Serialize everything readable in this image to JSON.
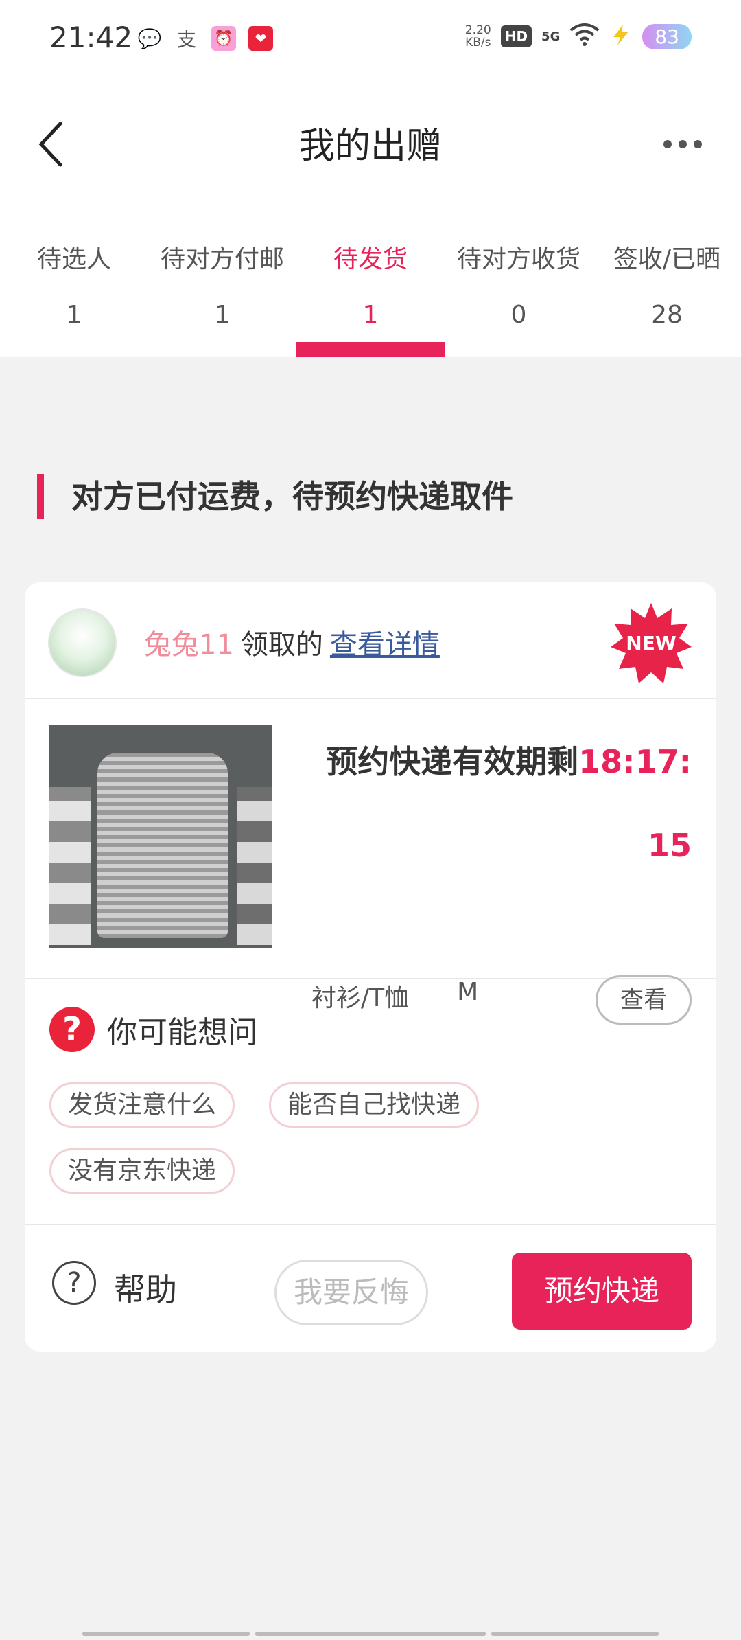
{
  "status_bar": {
    "time": "21:42",
    "apps": [
      {
        "icon": "wechat-icon",
        "glyph": "💬"
      },
      {
        "icon": "alipay-icon",
        "glyph": "支"
      },
      {
        "icon": "clock-app-icon",
        "glyph": "⏰"
      },
      {
        "icon": "taobao-618-icon",
        "glyph": "❤"
      }
    ],
    "net_speed_value": "2.20",
    "net_speed_unit": "KB/s",
    "hd": "HD",
    "signal": "5G",
    "battery": "83"
  },
  "header": {
    "title": "我的出赠"
  },
  "tabs": [
    {
      "label": "待选人",
      "count": "1",
      "active": false
    },
    {
      "label": "待对方付邮",
      "count": "1",
      "active": false
    },
    {
      "label": "待发货",
      "count": "1",
      "active": true
    },
    {
      "label": "待对方收货",
      "count": "0",
      "active": false
    },
    {
      "label": "签收/已晒",
      "count": "28",
      "active": false
    }
  ],
  "section": {
    "title": "对方已付运费，待预约快递取件"
  },
  "card": {
    "recipient_name": "兔兔11",
    "received_text": "领取的",
    "details_link": "查看详情",
    "new_badge": "NEW",
    "expire_label": "预约快递有效期剩",
    "countdown": "18:17:15",
    "category": "衬衫/T恤",
    "size": "M",
    "view_button": "查看",
    "faq_title": "你可能想问",
    "faq_chips": [
      "发货注意什么",
      "能否自己找快递",
      "没有京东快递"
    ],
    "help_label": "帮助",
    "regret_button": "我要反悔",
    "book_button": "预约快递"
  },
  "colors": {
    "accent": "#e8235a",
    "link": "#3a5a9c",
    "background": "#f2f2f2"
  }
}
